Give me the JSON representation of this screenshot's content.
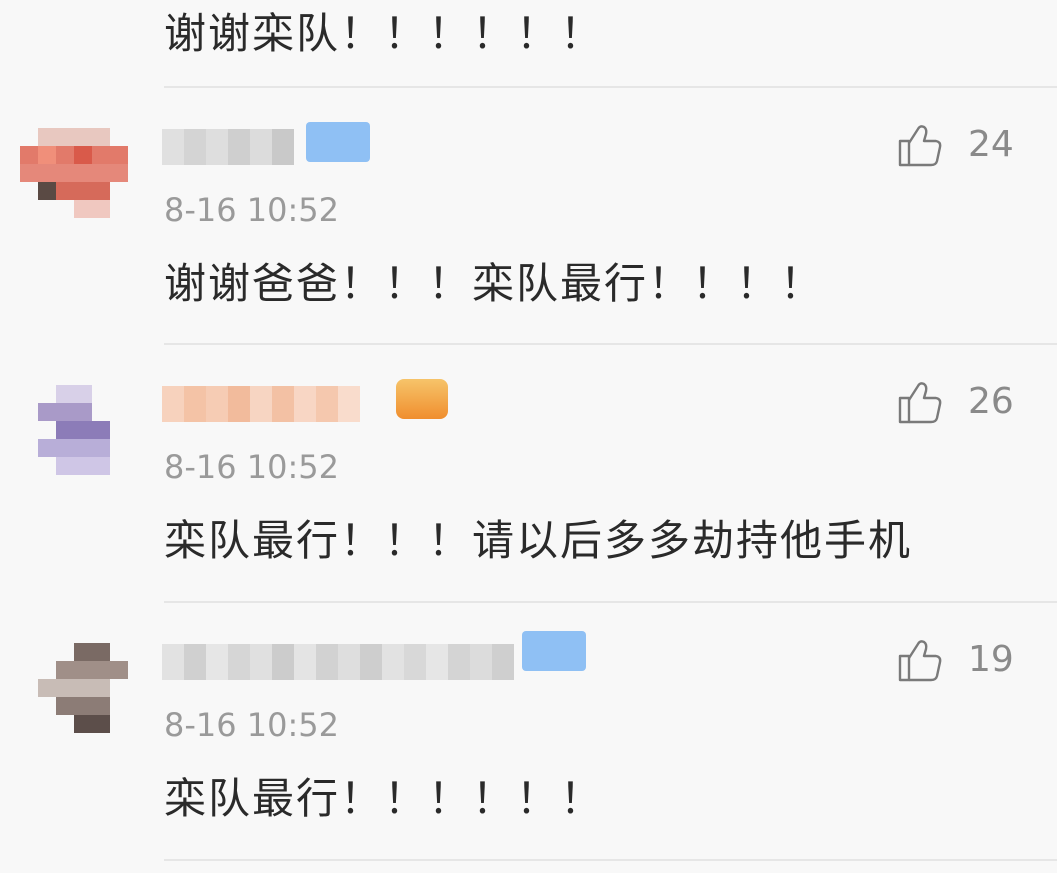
{
  "top_comment": {
    "text": "谢谢栾队！！！！！！"
  },
  "comments": [
    {
      "timestamp": "8-16 10:52",
      "text": "谢谢爸爸！！！栾队最行！！！！",
      "likes": "24",
      "badge_color": "#7fb6f2"
    },
    {
      "timestamp": "8-16 10:52",
      "text": "栾队最行！！！请以后多多劫持他手机",
      "likes": "26",
      "badge_color": "#f0a43a"
    },
    {
      "timestamp": "8-16 10:52",
      "text": "栾队最行！！！！！！",
      "likes": "19",
      "badge_color": "#7fb6f2"
    }
  ],
  "icons": {
    "like": "thumbs-up-icon"
  }
}
